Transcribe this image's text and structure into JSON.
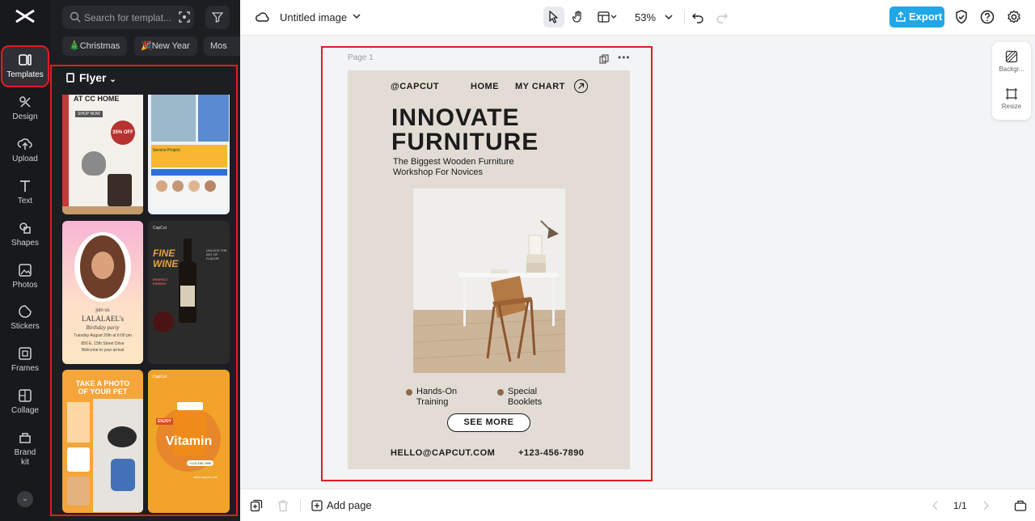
{
  "sidebar": {
    "items": [
      {
        "label": "Templates",
        "icon": "templates-icon"
      },
      {
        "label": "Design",
        "icon": "design-icon"
      },
      {
        "label": "Upload",
        "icon": "upload-icon"
      },
      {
        "label": "Text",
        "icon": "text-icon"
      },
      {
        "label": "Shapes",
        "icon": "shapes-icon"
      },
      {
        "label": "Photos",
        "icon": "photos-icon"
      },
      {
        "label": "Stickers",
        "icon": "stickers-icon"
      },
      {
        "label": "Frames",
        "icon": "frames-icon"
      },
      {
        "label": "Collage",
        "icon": "collage-icon"
      },
      {
        "label": "Brand kit",
        "icon": "brand-kit-icon"
      }
    ]
  },
  "panel": {
    "search_placeholder": "Search for templat...",
    "chips": [
      "🎄Christmas",
      "🎉New Year",
      "Mos"
    ],
    "category": "Flyer",
    "thumbs": {
      "t1_text": "AT CC HOME",
      "t1_shop": "SHOP NOW",
      "t1_badge": "35% OFF",
      "t2_service": "Service Project",
      "t3_name": "LALALAEL's",
      "t3_party": "Birthday party",
      "t3_join": "join us",
      "t3_date": "Tuesday August 20th at 6:00 pm",
      "t3_addr": "850 E. 15th Street Drive",
      "t3_welcome": "Welcome to your arrival",
      "t4_brand": "CapCut",
      "t4_title1": "FINE",
      "t4_title2": "WINE",
      "t4_pair": "PERFECT PAIRING",
      "t4_unlock": "UNLOCK THE ART OF FLAVOR",
      "t5_title1": "TAKE A PHOTO",
      "t5_title2": "OF YOUR PET",
      "t6_brand": "CapCut",
      "t6_title": "Vitamin",
      "t6_enjoy": "ENJOY",
      "t6_phone": "+123-456-7890",
      "t6_site": "www.capcut.com"
    }
  },
  "topbar": {
    "title": "Untitled image",
    "zoom": "53%",
    "export_label": "Export"
  },
  "canvas": {
    "page_label": "Page 1",
    "flyer": {
      "brand": "@CAPCUT",
      "nav_home": "HOME",
      "nav_chart": "MY CHART",
      "title_line1": "INNOVATE",
      "title_line2": "FURNITURE",
      "subtitle_line1": "The Biggest Wooden Furniture",
      "subtitle_line2": "Workshop For Novices",
      "bullet1_line1": "Hands-On",
      "bullet1_line2": "Training",
      "bullet2_line1": "Special",
      "bullet2_line2": "Booklets",
      "cta": "SEE MORE",
      "email": "HELLO@CAPCUT.COM",
      "phone": "+123-456-7890"
    }
  },
  "side_panel": {
    "background_label": "Backgr...",
    "resize_label": "Resize"
  },
  "bottombar": {
    "add_page": "Add page",
    "pager": "1/1"
  },
  "colors": {
    "accent": "#1fa7e8",
    "highlight": "#e11c24",
    "rail_bg": "#18191c",
    "panel_bg": "#1d1e22",
    "flyer_bg": "#e2dcd4"
  }
}
